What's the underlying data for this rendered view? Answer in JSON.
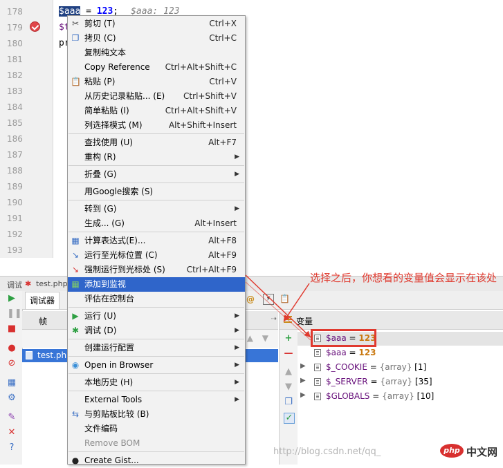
{
  "editor": {
    "line_numbers": [
      "178",
      "179",
      "180",
      "181",
      "182",
      "183",
      "184",
      "185",
      "186",
      "187",
      "188",
      "189",
      "190",
      "191",
      "192",
      "193"
    ],
    "line178": {
      "var": "$aaa",
      "op": " = ",
      "num": "123",
      "semi": ";",
      "hint": "$aaa: 123"
    },
    "line179": {
      "text": "$t"
    },
    "line180": {
      "text": "pr"
    }
  },
  "debug_panel": {
    "title_label": "调试",
    "title_file": "test.php",
    "tab_debugger": "调试器",
    "frames_header": "帧",
    "frame_selected": "test.php",
    "variables_header": "变量",
    "variables": [
      {
        "name": "$aaa",
        "eq": " = ",
        "value": "123",
        "expandable": false
      },
      {
        "name": "$aaa",
        "eq": " = ",
        "value": "123",
        "expandable": false
      },
      {
        "name": "$_COOKIE",
        "eq": " = ",
        "type": "{array}",
        "count": "[1]",
        "expandable": true
      },
      {
        "name": "$_SERVER",
        "eq": " = ",
        "type": "{array}",
        "count": "[35]",
        "expandable": true
      },
      {
        "name": "$GLOBALS",
        "eq": " = ",
        "type": "{array}",
        "count": "[10]",
        "expandable": true
      }
    ]
  },
  "context_menu": {
    "items": [
      {
        "label": "剪切 (T)",
        "shortcut": "Ctrl+X",
        "icon": "scissors-icon"
      },
      {
        "label": "拷贝 (C)",
        "shortcut": "Ctrl+C",
        "icon": "copy-icon"
      },
      {
        "label": "复制纯文本",
        "shortcut": ""
      },
      {
        "label": "Copy Reference",
        "shortcut": "Ctrl+Alt+Shift+C"
      },
      {
        "label": "粘贴 (P)",
        "shortcut": "Ctrl+V",
        "icon": "paste-icon"
      },
      {
        "label": "从历史记录粘贴... (E)",
        "shortcut": "Ctrl+Shift+V"
      },
      {
        "label": "简单粘贴 (I)",
        "shortcut": "Ctrl+Alt+Shift+V"
      },
      {
        "label": "列选择模式 (M)",
        "shortcut": "Alt+Shift+Insert"
      },
      {
        "label": "查找使用 (U)",
        "shortcut": "Alt+F7"
      },
      {
        "label": "重构 (R)",
        "submenu": true
      },
      {
        "label": "折叠 (G)",
        "submenu": true
      },
      {
        "label": "用Google搜索 (S)",
        "shortcut": ""
      },
      {
        "label": "转到 (G)",
        "submenu": true
      },
      {
        "label": "生成... (G)",
        "shortcut": "Alt+Insert"
      },
      {
        "label": "计算表达式(E)...",
        "shortcut": "Alt+F8",
        "icon": "calculator-icon"
      },
      {
        "label": "运行至光标位置 (C)",
        "shortcut": "Alt+F9",
        "icon": "run-to-cursor-icon"
      },
      {
        "label": "强制运行到光标处 (S)",
        "shortcut": "Ctrl+Alt+F9",
        "icon": "force-run-to-cursor-icon"
      },
      {
        "label": "添加到监视",
        "shortcut": "",
        "icon": "add-watch-icon",
        "active": true
      },
      {
        "label": "评估在控制台",
        "shortcut": ""
      },
      {
        "label": "运行 (U)",
        "submenu": true,
        "icon": "run-icon"
      },
      {
        "label": "调试 (D)",
        "submenu": true,
        "icon": "debug-icon"
      },
      {
        "label": "创建运行配置",
        "submenu": true
      },
      {
        "label": "Open in Browser",
        "submenu": true,
        "icon": "browser-icon"
      },
      {
        "label": "本地历史 (H)",
        "submenu": true
      },
      {
        "label": "External Tools",
        "submenu": true
      },
      {
        "label": "与剪贴板比较 (B)",
        "shortcut": "",
        "icon": "compare-icon"
      },
      {
        "label": "文件编码",
        "shortcut": ""
      },
      {
        "label": "Remove BOM",
        "shortcut": "",
        "disabled": true
      },
      {
        "label": "Create Gist...",
        "shortcut": "",
        "icon": "github-icon"
      }
    ]
  },
  "annotation": {
    "text": "选择之后，你想看的变量值会显示在该处"
  },
  "watermark": {
    "text": "http://blog.csdn.net/qq_",
    "logo_php": "php",
    "logo_cn": "中文网"
  },
  "colors": {
    "accent_red": "#e03a2f",
    "menu_highlight": "#2f65ca",
    "selection_blue": "#3875d7"
  }
}
